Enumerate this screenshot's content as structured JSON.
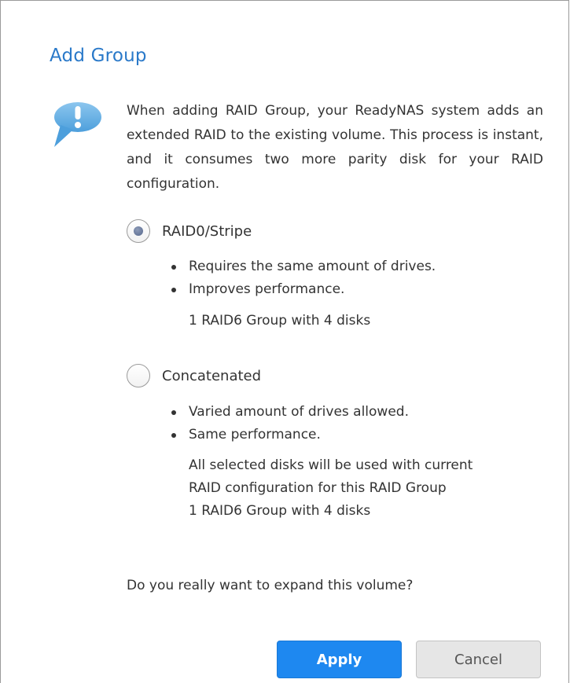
{
  "dialog": {
    "title": "Add Group",
    "message": "When adding RAID Group, your ReadyNAS system adds an extended RAID to the existing volume. This process is instant, and it consumes two more parity disk for your RAID configuration.",
    "icon": "info-bubble-icon",
    "accent_color": "#2a79c9"
  },
  "options": [
    {
      "label": "RAID0/Stripe",
      "selected": true,
      "bullets": [
        "Requires the same amount of drives.",
        "Improves performance."
      ],
      "note_lines": [
        "1 RAID6 Group with 4 disks"
      ]
    },
    {
      "label": "Concatenated",
      "selected": false,
      "bullets": [
        "Varied amount of drives allowed.",
        "Same performance."
      ],
      "note_lines": [
        "All selected disks will be used with current",
        "RAID configuration for this RAID Group",
        "1 RAID6 Group with 4 disks"
      ]
    }
  ],
  "question": "Do you really want to expand this volume?",
  "buttons": {
    "apply_label": "Apply",
    "cancel_label": "Cancel",
    "apply_color": "#1e88f0"
  }
}
